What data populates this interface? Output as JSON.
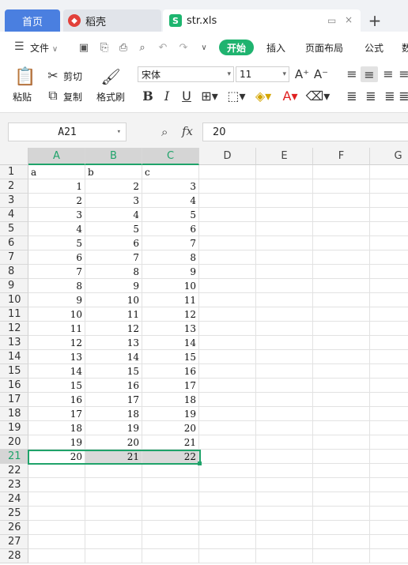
{
  "tabs": {
    "home": "首页",
    "daoke": "稻壳",
    "file": "str.xls",
    "file_icon": "S"
  },
  "menu": {
    "file": "文件",
    "start": "开始",
    "insert": "插入",
    "page_layout": "页面布局",
    "formula": "公式",
    "cut_more": "数"
  },
  "ribbon": {
    "paste": "粘贴",
    "cut": "剪切",
    "copy": "复制",
    "format_painter": "格式刷",
    "font_name": "宋体",
    "font_size": "11"
  },
  "formula_bar": {
    "cell_ref": "A21",
    "fx": "fx",
    "value": "20"
  },
  "grid": {
    "columns": [
      "A",
      "B",
      "C",
      "D",
      "E",
      "F",
      "G"
    ],
    "selected_columns": [
      "A",
      "B",
      "C"
    ],
    "selected_row": 21,
    "row_numbers": [
      1,
      2,
      3,
      4,
      5,
      6,
      7,
      8,
      9,
      10,
      11,
      12,
      13,
      14,
      15,
      16,
      17,
      18,
      19,
      20,
      21,
      22,
      23,
      24,
      25,
      26,
      27,
      28
    ],
    "rows": [
      [
        "a",
        "b",
        "c"
      ],
      [
        1,
        2,
        3
      ],
      [
        2,
        3,
        4
      ],
      [
        3,
        4,
        5
      ],
      [
        4,
        5,
        6
      ],
      [
        5,
        6,
        7
      ],
      [
        6,
        7,
        8
      ],
      [
        7,
        8,
        9
      ],
      [
        8,
        9,
        10
      ],
      [
        9,
        10,
        11
      ],
      [
        10,
        11,
        12
      ],
      [
        11,
        12,
        13
      ],
      [
        12,
        13,
        14
      ],
      [
        13,
        14,
        15
      ],
      [
        14,
        15,
        16
      ],
      [
        15,
        16,
        17
      ],
      [
        16,
        17,
        18
      ],
      [
        17,
        18,
        19
      ],
      [
        18,
        19,
        20
      ],
      [
        19,
        20,
        21
      ],
      [
        20,
        21,
        22
      ]
    ]
  },
  "colors": {
    "accent": "#1fa36a",
    "home_tab": "#4a7fe0"
  }
}
